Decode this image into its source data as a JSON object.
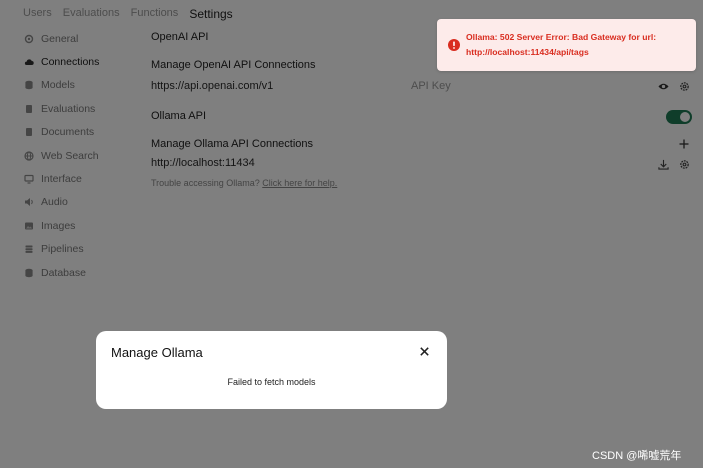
{
  "breadcrumb": [
    "Users",
    "Evaluations",
    "Functions",
    "Settings"
  ],
  "sidebar": {
    "items": [
      {
        "label": "General",
        "icon": "gear-icon",
        "active": false
      },
      {
        "label": "Connections",
        "icon": "cloud-icon",
        "active": true
      },
      {
        "label": "Models",
        "icon": "database-icon",
        "active": false
      },
      {
        "label": "Evaluations",
        "icon": "document-icon",
        "active": false
      },
      {
        "label": "Documents",
        "icon": "document-icon",
        "active": false
      },
      {
        "label": "Web Search",
        "icon": "globe-icon",
        "active": false
      },
      {
        "label": "Interface",
        "icon": "monitor-icon",
        "active": false
      },
      {
        "label": "Audio",
        "icon": "speaker-icon",
        "active": false
      },
      {
        "label": "Images",
        "icon": "image-icon",
        "active": false
      },
      {
        "label": "Pipelines",
        "icon": "layers-icon",
        "active": false
      },
      {
        "label": "Database",
        "icon": "database-icon",
        "active": false
      }
    ]
  },
  "openai": {
    "title": "OpenAI API",
    "manage_title": "Manage OpenAI API Connections",
    "url": "https://api.openai.com/v1",
    "api_key_placeholder": "API Key"
  },
  "ollama": {
    "title": "Ollama API",
    "manage_title": "Manage Ollama API Connections",
    "url": "http://localhost:11434",
    "help_text": "Trouble accessing Ollama?",
    "help_link": "Click here for help.",
    "enabled": true
  },
  "toast": {
    "line1": "Ollama: 502 Server Error: Bad Gateway for url:",
    "line2": "http://localhost:11434/api/tags",
    "color": "#d92d20"
  },
  "modal": {
    "title": "Manage Ollama",
    "message": "Failed to fetch models"
  },
  "watermark": "CSDN @唏嘘荒年",
  "colors": {
    "toggle_on": "#1f7a55",
    "overlay": "rgba(0,0,0,0.5)"
  }
}
